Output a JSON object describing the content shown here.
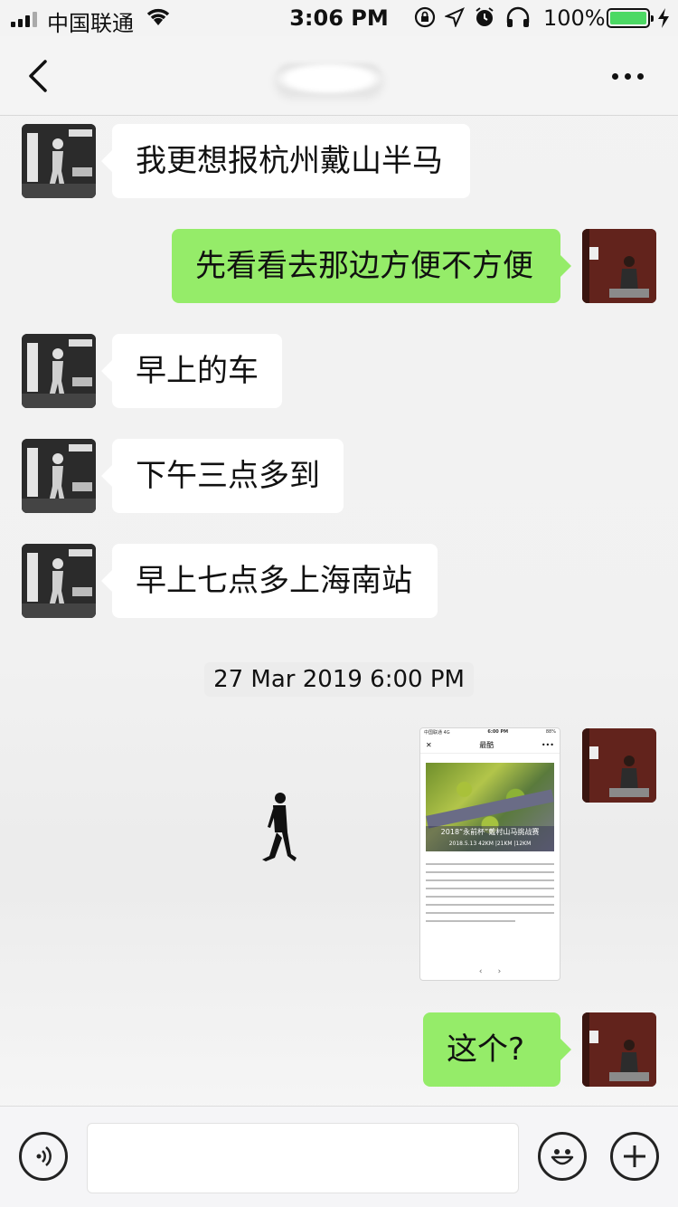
{
  "status_bar": {
    "carrier": "中国联通",
    "time": "3:06 PM",
    "battery_percent": "100%",
    "battery_level": 1.0,
    "icons": [
      "signal-icon",
      "wifi-icon",
      "rotation-lock-icon",
      "location-icon",
      "alarm-icon",
      "headphones-icon",
      "battery-icon",
      "charging-icon"
    ]
  },
  "nav": {
    "back_icon": "chevron-left-icon",
    "more_icon": "more-dots-icon"
  },
  "messages": [
    {
      "side": "left",
      "text": "我更想报杭州戴山半马"
    },
    {
      "side": "right",
      "text": "先看看去那边方便不方便"
    },
    {
      "side": "left",
      "text": "早上的车"
    },
    {
      "side": "left",
      "text": "下午三点多到"
    },
    {
      "side": "left",
      "text": "早上七点多上海南站"
    }
  ],
  "timestamp": "27 Mar 2019 6:00 PM",
  "image_message": {
    "status_carrier": "中国联通 4G",
    "status_time": "6:00 PM",
    "status_battery": "88%",
    "header_title": "最酷",
    "banner_title": "2018“永前杯”戴村山马挑战赛",
    "banner_sub": "2018.5.13 42KM |21KM |12KM"
  },
  "last_message": {
    "side": "right",
    "text": "这个?"
  },
  "input_bar": {
    "voice_icon": "voice-icon",
    "emoji_icon": "emoji-icon",
    "plus_icon": "plus-icon"
  },
  "colors": {
    "sent_bubble": "#95ec69",
    "received_bubble": "#ffffff",
    "battery_fill": "#4cd964"
  }
}
